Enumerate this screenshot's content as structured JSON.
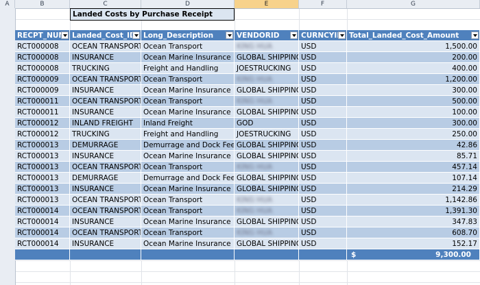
{
  "columns": [
    "A",
    "B",
    "C",
    "D",
    "E",
    "F",
    "G"
  ],
  "title": "Landed Costs by Purchase Receipt",
  "headers": [
    "RECPT_NUM",
    "Landed_Cost_ID",
    "Long_Description",
    "VENDORID",
    "CURNCYID",
    "Total_Landed_Cost_Amount"
  ],
  "rows": [
    [
      "RCT000008",
      "OCEAN TRANSPORT",
      "Ocean Transport",
      "KING HUA",
      "USD",
      "1,500.00"
    ],
    [
      "RCT000008",
      "INSURANCE",
      "Ocean Marine Insurance",
      "GLOBAL SHIPPING",
      "USD",
      "200.00"
    ],
    [
      "RCT000008",
      "TRUCKING",
      "Freight and Handling",
      "JOESTRUCKING",
      "USD",
      "400.00"
    ],
    [
      "RCT000009",
      "OCEAN TRANSPORT",
      "Ocean Transport",
      "KING HUA",
      "USD",
      "1,200.00"
    ],
    [
      "RCT000009",
      "INSURANCE",
      "Ocean Marine Insurance",
      "GLOBAL SHIPPING",
      "USD",
      "300.00"
    ],
    [
      "RCT000011",
      "OCEAN TRANSPORT",
      "Ocean Transport",
      "KING HUA",
      "USD",
      "500.00"
    ],
    [
      "RCT000011",
      "INSURANCE",
      "Ocean Marine Insurance",
      "GLOBAL SHIPPING",
      "USD",
      "100.00"
    ],
    [
      "RCT000012",
      "INLAND FREIGHT",
      "Inland Freight",
      "GOD",
      "USD",
      "300.00"
    ],
    [
      "RCT000012",
      "TRUCKING",
      "Freight and Handling",
      "JOESTRUCKING",
      "USD",
      "250.00"
    ],
    [
      "RCT000013",
      "DEMURRAGE",
      "Demurrage and Dock Fees",
      "GLOBAL SHIPPING",
      "USD",
      "42.86"
    ],
    [
      "RCT000013",
      "INSURANCE",
      "Ocean Marine Insurance",
      "GLOBAL SHIPPING",
      "USD",
      "85.71"
    ],
    [
      "RCT000013",
      "OCEAN TRANSPORT",
      "Ocean Transport",
      "KING HUA",
      "USD",
      "457.14"
    ],
    [
      "RCT000013",
      "DEMURRAGE",
      "Demurrage and Dock Fees",
      "GLOBAL SHIPPING",
      "USD",
      "107.14"
    ],
    [
      "RCT000013",
      "INSURANCE",
      "Ocean Marine Insurance",
      "GLOBAL SHIPPING",
      "USD",
      "214.29"
    ],
    [
      "RCT000013",
      "OCEAN TRANSPORT",
      "Ocean Transport",
      "KING HUA",
      "USD",
      "1,142.86"
    ],
    [
      "RCT000014",
      "OCEAN TRANSPORT",
      "Ocean Transport",
      "KING HUA",
      "USD",
      "1,391.30"
    ],
    [
      "RCT000014",
      "INSURANCE",
      "Ocean Marine Insurance",
      "GLOBAL SHIPPING",
      "USD",
      "347.83"
    ],
    [
      "RCT000014",
      "OCEAN TRANSPORT",
      "Ocean Transport",
      "KING HUA",
      "USD",
      "608.70"
    ],
    [
      "RCT000014",
      "INSURANCE",
      "Ocean Marine Insurance",
      "GLOBAL SHIPPING",
      "USD",
      "152.17"
    ]
  ],
  "blurred_vendor": "KING HUA",
  "total": {
    "currency": "$",
    "amount": "9,300.00"
  },
  "colors": {
    "header": "#4f81bd",
    "band_light": "#dbe5f1",
    "band_dark": "#b8cce4",
    "selected_col": "#f7d28b"
  }
}
